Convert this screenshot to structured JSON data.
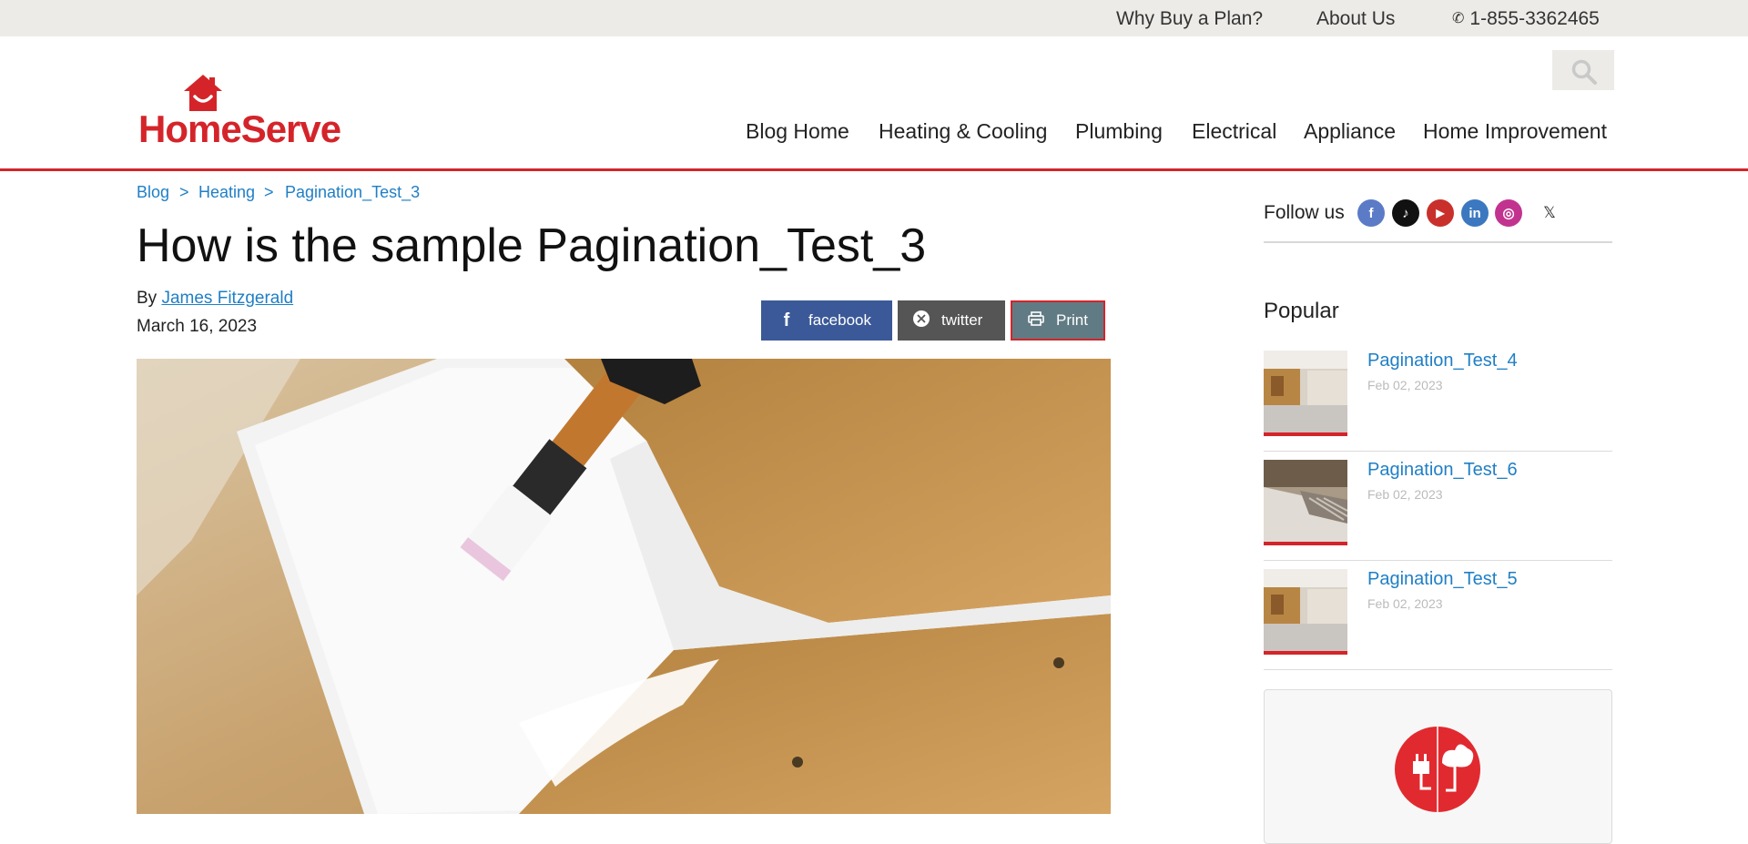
{
  "utility": {
    "why_buy": "Why Buy a Plan?",
    "about": "About Us",
    "phone": "1-855-3362465"
  },
  "brand": {
    "logo_text": "HomeServe",
    "color": "#d4242a"
  },
  "nav": {
    "items": [
      {
        "label": "Blog Home"
      },
      {
        "label": "Heating & Cooling"
      },
      {
        "label": "Plumbing"
      },
      {
        "label": "Electrical"
      },
      {
        "label": "Appliance"
      },
      {
        "label": "Home Improvement"
      }
    ]
  },
  "breadcrumb": {
    "items": [
      {
        "label": "Blog"
      },
      {
        "label": "Heating"
      },
      {
        "label": "Pagination_Test_3"
      }
    ],
    "separator": ">"
  },
  "article": {
    "title": "How is the sample Pagination_Test_3",
    "by_prefix": "By",
    "author": "James Fitzgerald",
    "date": "March 16, 2023"
  },
  "share": {
    "facebook": "facebook",
    "twitter": "twitter",
    "print": "Print"
  },
  "sidebar": {
    "follow_label": "Follow us",
    "social": [
      {
        "icon": "facebook-icon",
        "glyph": "f",
        "color": "#5b7bc7"
      },
      {
        "icon": "tiktok-icon",
        "glyph": "♪",
        "color": "#111111"
      },
      {
        "icon": "youtube-icon",
        "glyph": "▶",
        "color": "#c9302c"
      },
      {
        "icon": "linkedin-icon",
        "glyph": "in",
        "color": "#3b78c0"
      },
      {
        "icon": "instagram-icon",
        "glyph": "◎",
        "color": "#c2338f"
      },
      {
        "icon": "x-icon",
        "glyph": "𝕏",
        "color": "#ffffff"
      }
    ],
    "popular_heading": "Popular",
    "popular": [
      {
        "title": "Pagination_Test_4",
        "date": "Feb 02, 2023"
      },
      {
        "title": "Pagination_Test_6",
        "date": "Feb 02, 2023"
      },
      {
        "title": "Pagination_Test_5",
        "date": "Feb 02, 2023"
      }
    ]
  }
}
